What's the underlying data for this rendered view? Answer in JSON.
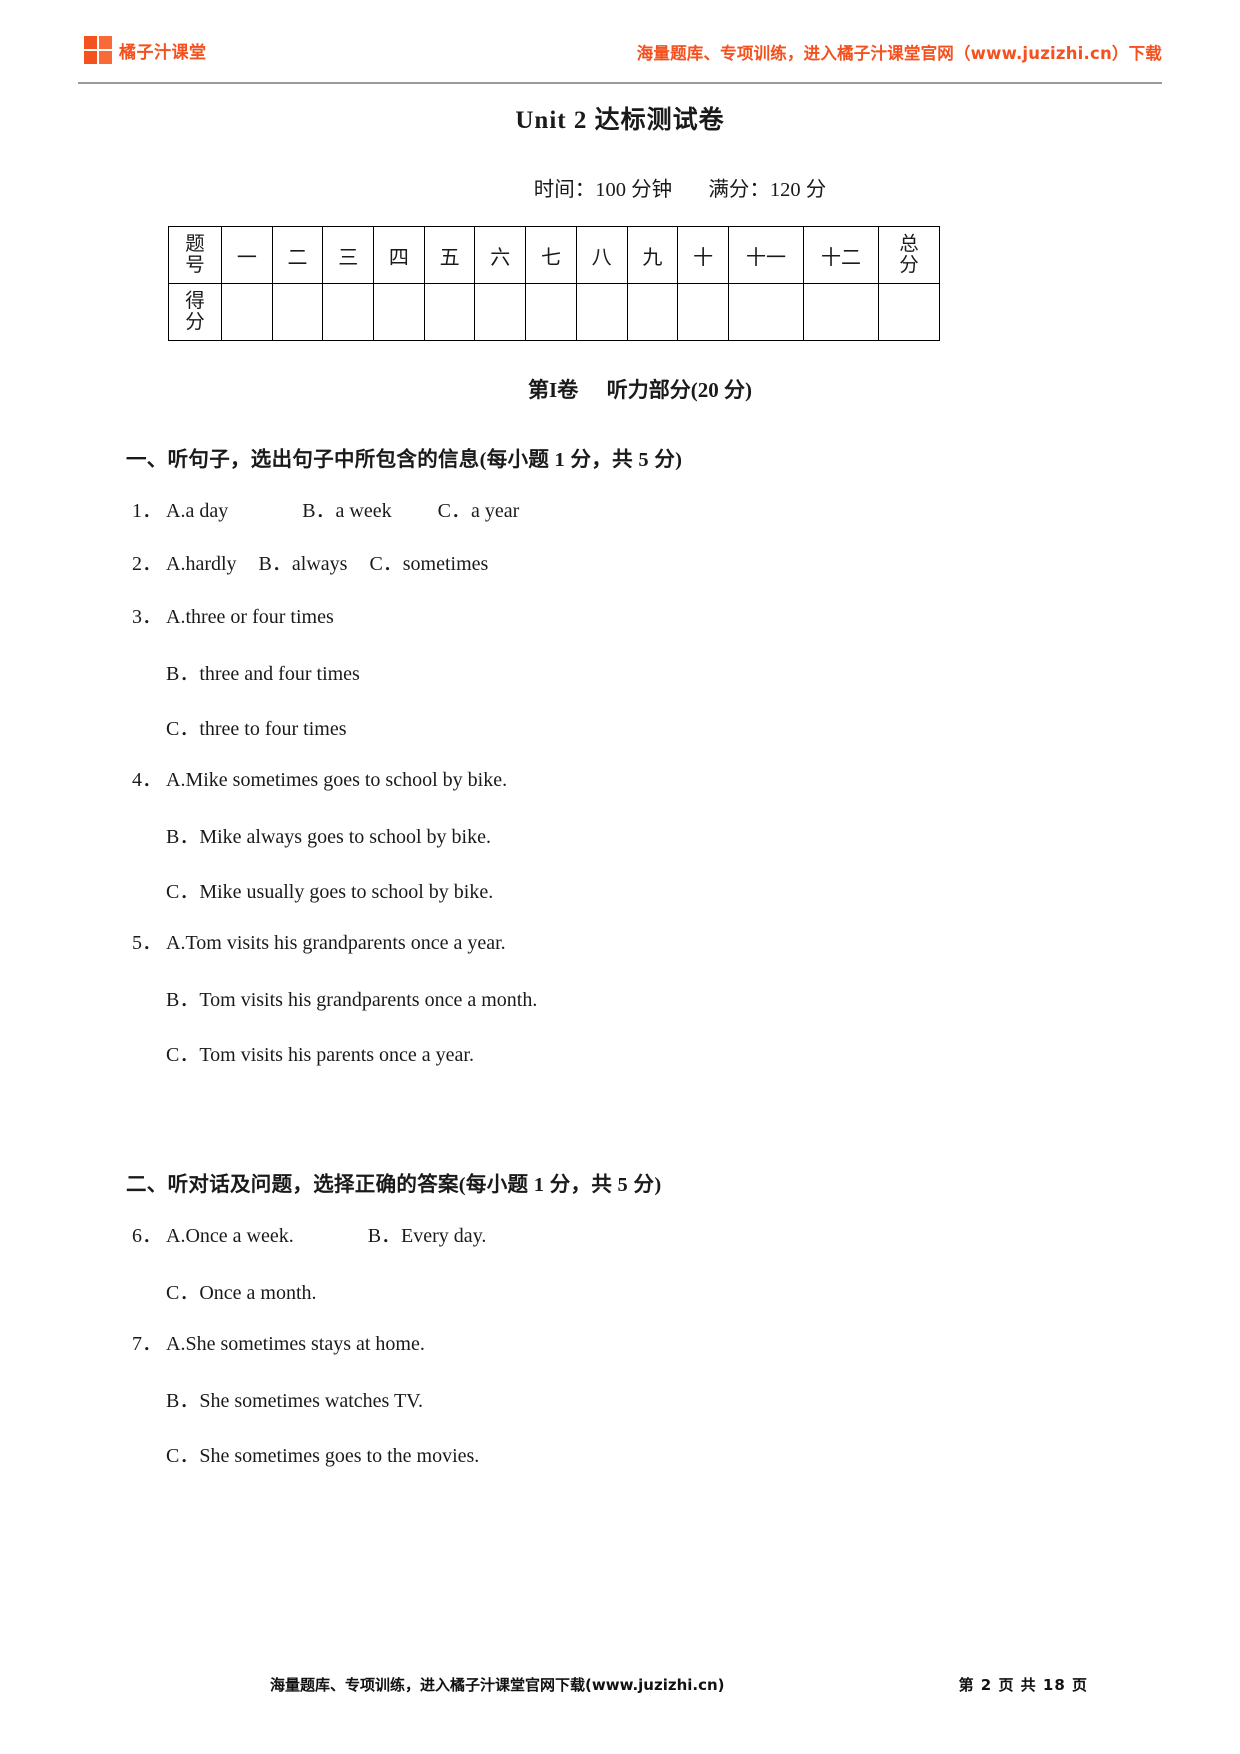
{
  "header": {
    "brand_name": "橘子汁课堂",
    "promo": "海量题库、专项训练，进入橘子汁课堂官网（www.juzizhi.cn）下载",
    "brand_color": "#f4511e"
  },
  "title": "Unit 2 达标测试卷",
  "exam_meta": {
    "time_label": "时间：100 分钟",
    "score_label": "满分：120 分"
  },
  "score_table": {
    "row_head_1_line1": "题",
    "row_head_1_line2": "号",
    "row_head_2_line1": "得",
    "row_head_2_line2": "分",
    "columns": [
      "一",
      "二",
      "三",
      "四",
      "五",
      "六",
      "七",
      "八",
      "九",
      "十",
      "十一",
      "十二"
    ],
    "total_line1": "总",
    "total_line2": "分",
    "answers": [
      "",
      "",
      "",
      "",
      "",
      "",
      "",
      "",
      "",
      "",
      "",
      "",
      ""
    ]
  },
  "part_heading": {
    "volume": "第I卷",
    "name": "听力部分(20 分)"
  },
  "sections": [
    {
      "heading": "一、听句子，选出句子中所包含的信息(每小题 1 分，共 5 分)",
      "questions": [
        {
          "num": "1．",
          "lines": [
            [
              {
                "text": "A.a day",
                "gap": "lg"
              },
              {
                "text": "B．a week",
                "gap": "md"
              },
              {
                "text": "C．a year",
                "gap": ""
              }
            ]
          ]
        },
        {
          "num": "2．",
          "lines": [
            [
              {
                "text": "A.hardly",
                "gap": "sm"
              },
              {
                "text": "B．always",
                "gap": "sm"
              },
              {
                "text": "C．sometimes",
                "gap": ""
              }
            ]
          ]
        },
        {
          "num": "3．",
          "lines": [
            [
              {
                "text": "A.three or four times",
                "gap": ""
              }
            ],
            [
              {
                "text": "B．three and four times",
                "gap": ""
              }
            ],
            [
              {
                "text": "C．three to four times",
                "gap": ""
              }
            ]
          ]
        },
        {
          "num": "4．",
          "lines": [
            [
              {
                "text": "A.Mike sometimes goes to school by bike.",
                "gap": ""
              }
            ],
            [
              {
                "text": "B．Mike always goes to school by bike.",
                "gap": ""
              }
            ],
            [
              {
                "text": "C．Mike usually goes to school by bike.",
                "gap": ""
              }
            ]
          ]
        },
        {
          "num": "5．",
          "lines": [
            [
              {
                "text": "A.Tom visits his grandparents once a year.",
                "gap": ""
              }
            ],
            [
              {
                "text": "B．Tom visits his grandparents once a month.",
                "gap": ""
              }
            ],
            [
              {
                "text": "C．Tom visits his parents once a year.",
                "gap": ""
              }
            ]
          ]
        }
      ]
    },
    {
      "heading": "二、听对话及问题，选择正确的答案(每小题 1 分，共 5 分)",
      "questions": [
        {
          "num": "6．",
          "lines": [
            [
              {
                "text": "A.Once a week.",
                "gap": "lg"
              },
              {
                "text": "B．Every day.",
                "gap": ""
              }
            ],
            [
              {
                "text": "C．Once a month.",
                "gap": ""
              }
            ]
          ]
        },
        {
          "num": "7．",
          "lines": [
            [
              {
                "text": "A.She sometimes stays at home.",
                "gap": ""
              }
            ],
            [
              {
                "text": "B．She sometimes watches TV.",
                "gap": ""
              }
            ],
            [
              {
                "text": "C．She sometimes goes to the movies.",
                "gap": ""
              }
            ]
          ]
        }
      ]
    }
  ],
  "footer": {
    "promo": "海量题库、专项训练，进入橘子汁课堂官网下载(www.juzizhi.cn)",
    "page_info": "第 2 页 共 18 页"
  }
}
